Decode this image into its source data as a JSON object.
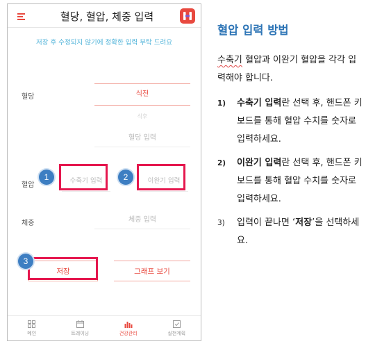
{
  "app": {
    "title": "혈당, 혈압, 체중 입력",
    "notice": "저장 후 수정되지 않기에 정확한 입력 부탁 드려요"
  },
  "form": {
    "glucose": {
      "label": "혈당",
      "meal_value": "식전",
      "meal_sub": "식후",
      "placeholder": "혈당 입력"
    },
    "blood_pressure": {
      "label": "혈압",
      "systolic_placeholder": "수축기 입력",
      "diastolic_placeholder": "이완기 입력"
    },
    "weight": {
      "label": "체중",
      "placeholder": "체중 입력"
    },
    "save_label": "저장",
    "graph_label": "그래프 보기"
  },
  "badges": [
    "1",
    "2",
    "3"
  ],
  "tabs": [
    {
      "label": "메인",
      "icon": "grid-icon",
      "active": false
    },
    {
      "label": "트레이닝",
      "icon": "calendar-icon",
      "active": false
    },
    {
      "label": "건강관리",
      "icon": "bar-chart-icon",
      "active": true
    },
    {
      "label": "실천계획",
      "icon": "plan-icon",
      "active": false
    }
  ],
  "colors": {
    "accent": "#e8493f",
    "notice": "#4fb3d9",
    "highlight": "#e5174e",
    "badge": "#3d7ec2",
    "guide_title": "#2e75b6"
  },
  "guide": {
    "title": "혈압 입력 방법",
    "intro_part1": "수축기",
    "intro_part2": " 혈압과 이완기 혈압을 각각 입력해야 합니다.",
    "steps": [
      {
        "num": "1)",
        "bold": "수축기 입력",
        "text": "란 선택 후, 핸드폰 키보드를 통해 혈압 수치를 숫자로 입력하세요."
      },
      {
        "num": "2)",
        "bold": "이완기 입력",
        "text": "란 선택 후, 핸드폰 키보드를 통해 혈압 수치를 숫자로 입력하세요."
      },
      {
        "num": "3)",
        "pre": "입력이 끝나면 ‘",
        "bold": "저장",
        "text": "’을 선택하세요."
      }
    ]
  }
}
